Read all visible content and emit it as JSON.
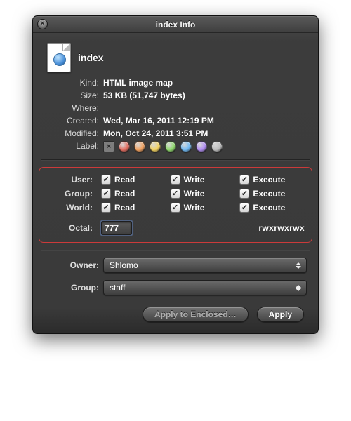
{
  "window": {
    "title": "index Info"
  },
  "file": {
    "name": "index"
  },
  "meta": {
    "kind_label": "Kind:",
    "kind_value": "HTML image map",
    "size_label": "Size:",
    "size_value": "53 KB (51,747 bytes)",
    "where_label": "Where:",
    "created_label": "Created:",
    "created_value": "Wed, Mar 16, 2011 12:19 PM",
    "modified_label": "Modified:",
    "modified_value": "Mon, Oct 24, 2011 3:51 PM",
    "label_label": "Label:"
  },
  "label_colors": [
    "#e46b5e",
    "#f2a15e",
    "#f4d35e",
    "#8fd96b",
    "#6fb9f4",
    "#b18cf4",
    "#bdbdbd"
  ],
  "perm": {
    "rows": [
      {
        "name": "User:",
        "read": "Read",
        "write": "Write",
        "exec": "Execute"
      },
      {
        "name": "Group:",
        "read": "Read",
        "write": "Write",
        "exec": "Execute"
      },
      {
        "name": "World:",
        "read": "Read",
        "write": "Write",
        "exec": "Execute"
      }
    ],
    "octal_label": "Octal:",
    "octal_value": "777",
    "posix": "rwxrwxrwx"
  },
  "owner": {
    "owner_label": "Owner:",
    "owner_value": "Shlomo",
    "group_label": "Group:",
    "group_value": "staff"
  },
  "buttons": {
    "apply_enclosed": "Apply to Enclosed…",
    "apply": "Apply"
  }
}
